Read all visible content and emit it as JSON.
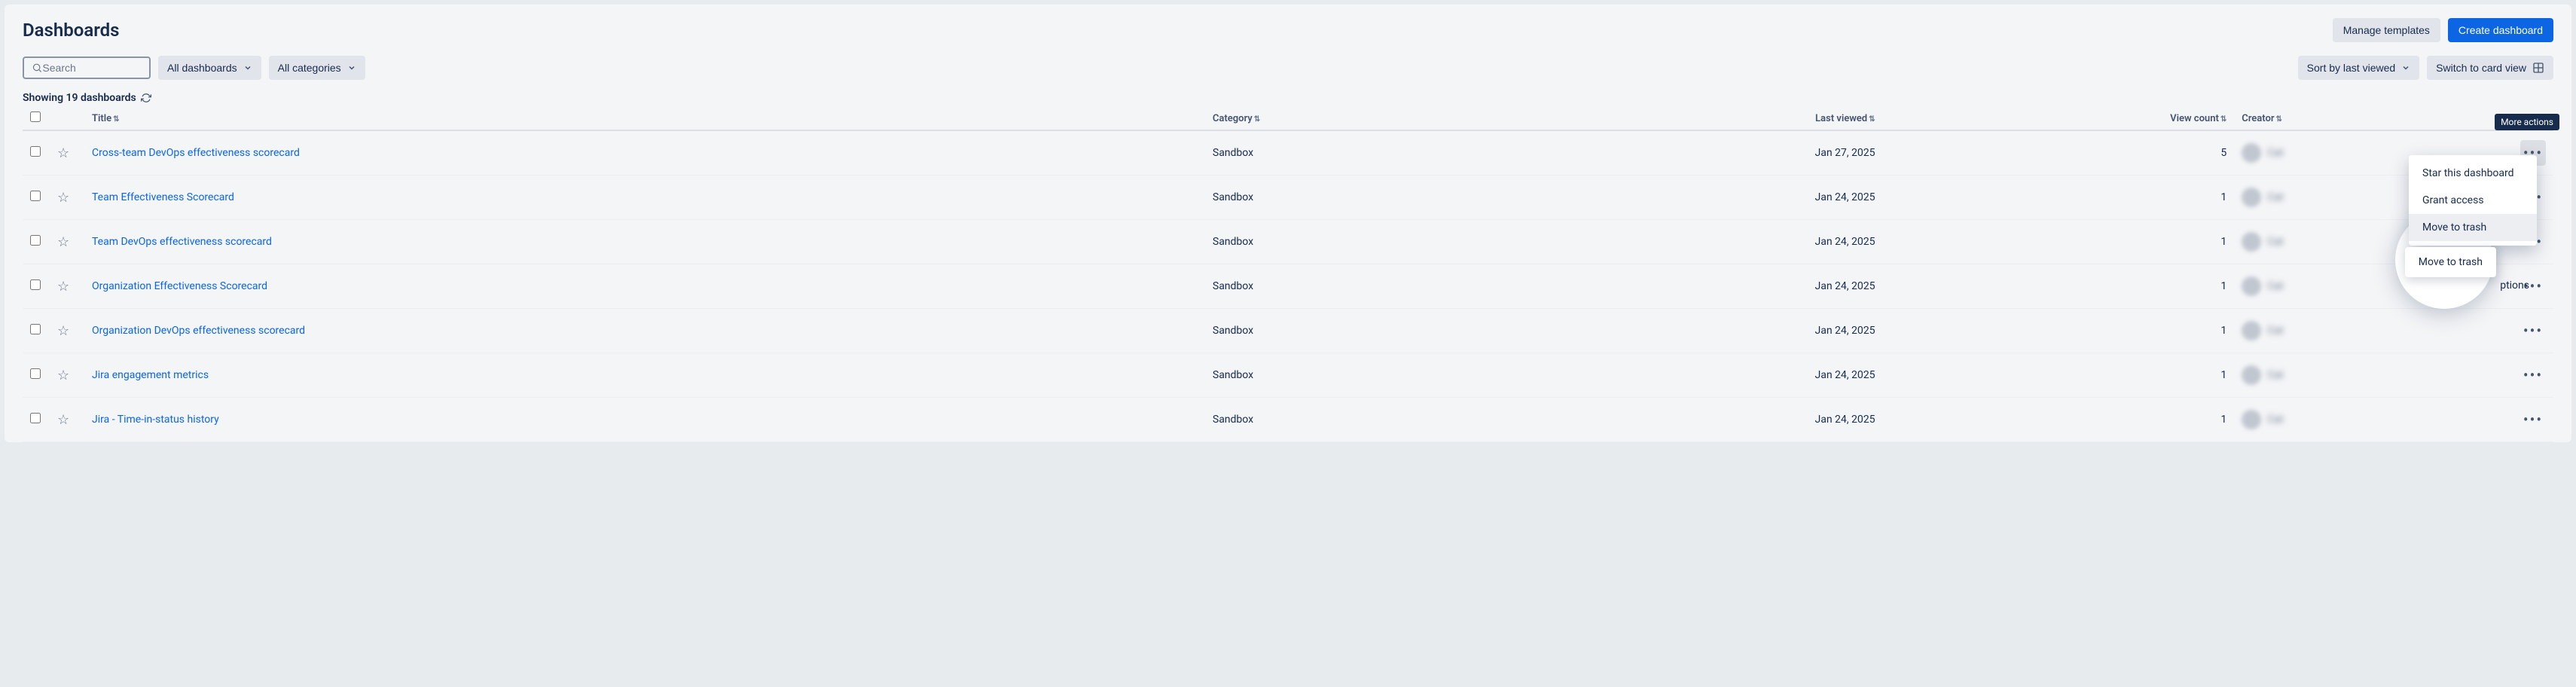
{
  "header": {
    "title": "Dashboards",
    "manage_templates": "Manage templates",
    "create_dashboard": "Create dashboard"
  },
  "controls": {
    "search_placeholder": "Search",
    "all_dashboards": "All dashboards",
    "all_categories": "All categories",
    "sort_label": "Sort by last viewed",
    "switch_view": "Switch to card view"
  },
  "summary": "Showing 19 dashboards",
  "columns": {
    "title": "Title",
    "category": "Category",
    "last_viewed": "Last viewed",
    "view_count": "View count",
    "creator": "Creator"
  },
  "tooltip": "More actions",
  "menu": {
    "star": "Star this dashboard",
    "grant": "Grant access",
    "trash": "Move to trash",
    "subs": "ptions"
  },
  "rows": [
    {
      "title": "Cross-team DevOps effectiveness scorecard",
      "category": "Sandbox",
      "last_viewed": "Jan 27, 2025",
      "view_count": "5",
      "creator": "Cat"
    },
    {
      "title": "Team Effectiveness Scorecard",
      "category": "Sandbox",
      "last_viewed": "Jan 24, 2025",
      "view_count": "1",
      "creator": "Cat"
    },
    {
      "title": "Team DevOps effectiveness scorecard",
      "category": "Sandbox",
      "last_viewed": "Jan 24, 2025",
      "view_count": "1",
      "creator": "Cat"
    },
    {
      "title": "Organization Effectiveness Scorecard",
      "category": "Sandbox",
      "last_viewed": "Jan 24, 2025",
      "view_count": "1",
      "creator": "Cat"
    },
    {
      "title": "Organization DevOps effectiveness scorecard",
      "category": "Sandbox",
      "last_viewed": "Jan 24, 2025",
      "view_count": "1",
      "creator": "Cat"
    },
    {
      "title": "Jira engagement metrics",
      "category": "Sandbox",
      "last_viewed": "Jan 24, 2025",
      "view_count": "1",
      "creator": "Cat"
    },
    {
      "title": "Jira - Time-in-status history",
      "category": "Sandbox",
      "last_viewed": "Jan 24, 2025",
      "view_count": "1",
      "creator": "Cat"
    }
  ]
}
